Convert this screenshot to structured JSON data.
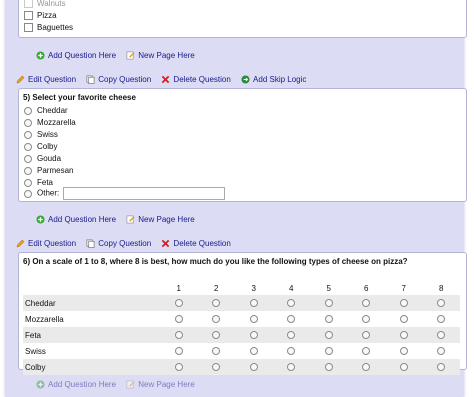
{
  "prev_question": {
    "options": [
      "Walnuts",
      "Pizza",
      "Baguettes"
    ]
  },
  "add_row_1": {
    "add_question": "Add Question Here",
    "new_page": "New Page Here"
  },
  "toolbar_1": {
    "edit": "Edit Question",
    "copy": "Copy Question",
    "delete": "Delete Question",
    "skip": "Add Skip Logic"
  },
  "q5": {
    "title": "5) Select your favorite cheese",
    "options": [
      "Cheddar",
      "Mozzarella",
      "Swiss",
      "Colby",
      "Gouda",
      "Parmesan",
      "Feta"
    ],
    "other_label": "Other:"
  },
  "add_row_2": {
    "add_question": "Add Question Here",
    "new_page": "New Page Here"
  },
  "toolbar_2": {
    "edit": "Edit Question",
    "copy": "Copy Question",
    "delete": "Delete Question"
  },
  "q6": {
    "title": "6) On a scale of 1 to 8, where 8 is best, how much do you like the following types of cheese on pizza?",
    "scale": [
      "1",
      "2",
      "3",
      "4",
      "5",
      "6",
      "7",
      "8"
    ],
    "rows": [
      "Cheddar",
      "Mozzarella",
      "Feta",
      "Swiss",
      "Colby"
    ]
  },
  "add_row_3": {
    "add_question": "Add Question Here",
    "new_page": "New Page Here"
  },
  "colors": {
    "panel": "#dcdcf4",
    "link": "#1a1a8a",
    "add_green": "#3aa63a",
    "delete_red": "#d42020"
  }
}
